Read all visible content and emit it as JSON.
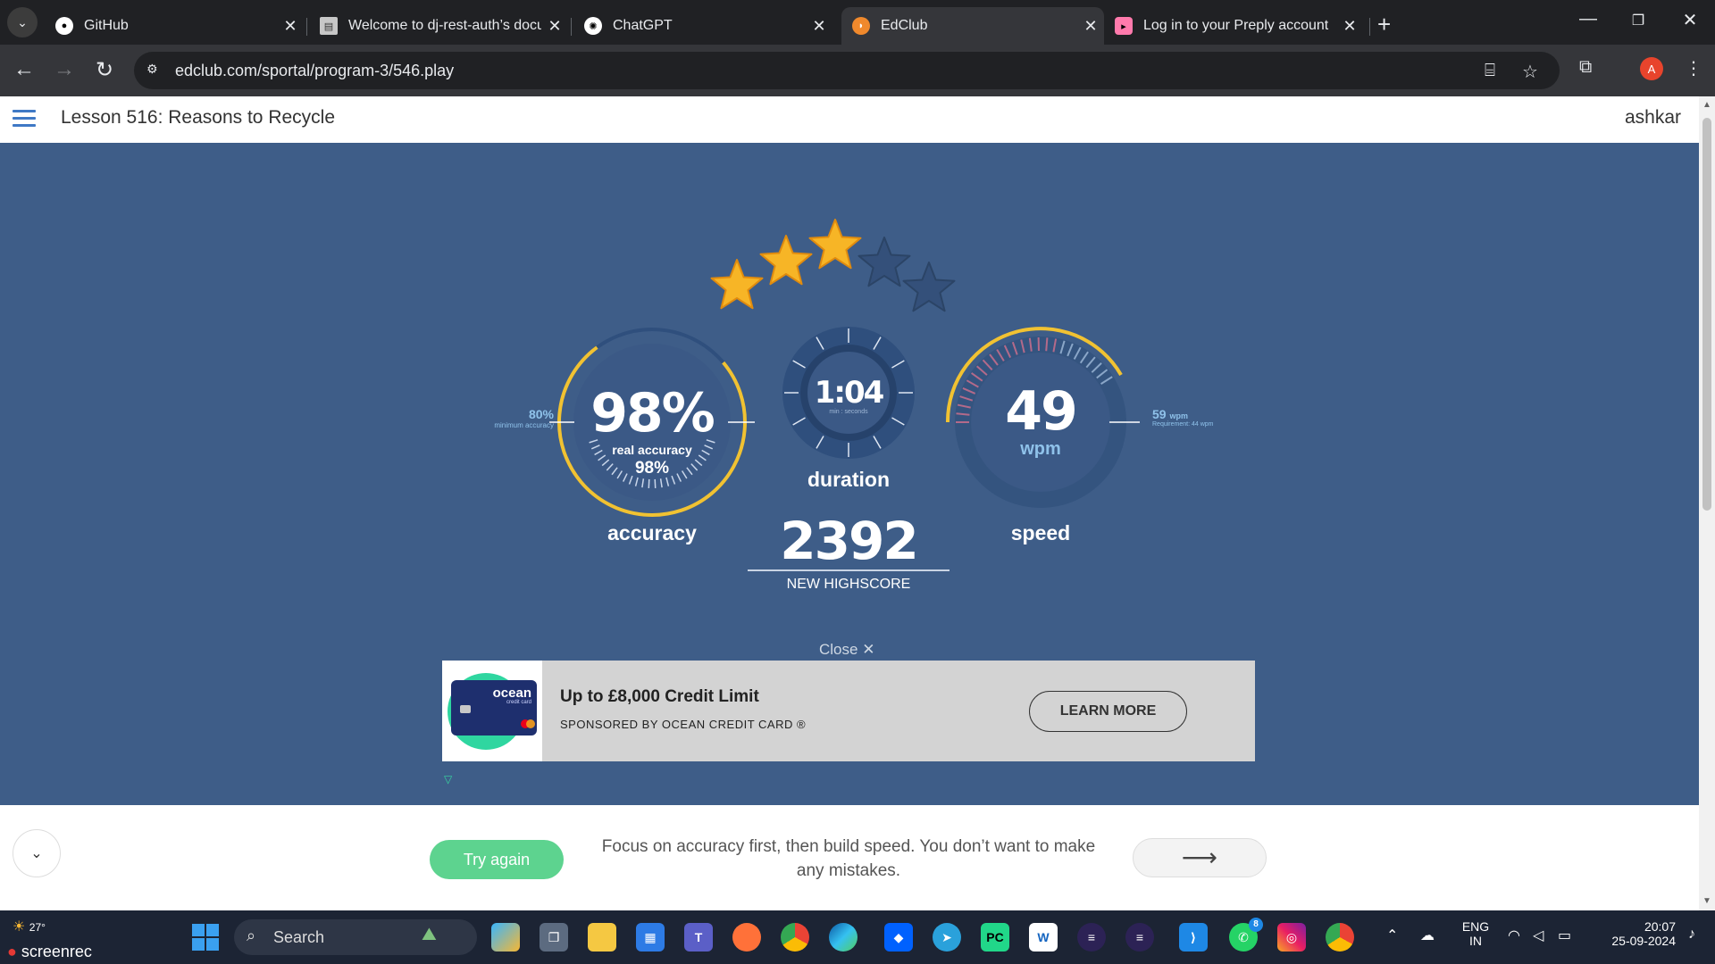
{
  "browser": {
    "tabs": [
      {
        "title": "GitHub",
        "icon": "github-icon"
      },
      {
        "title": "Welcome to dj-rest-auth’s docu",
        "icon": "doc-icon"
      },
      {
        "title": "ChatGPT",
        "icon": "chatgpt-icon"
      },
      {
        "title": "EdClub",
        "icon": "edclub-icon",
        "active": true
      },
      {
        "title": "Log in to your Preply account",
        "icon": "preply-icon"
      }
    ],
    "url": "edclub.com/sportal/program-3/546.play",
    "profile_initial": "A"
  },
  "page": {
    "lesson_title": "Lesson 516: Reasons to Recycle",
    "username": "ashkar",
    "stars_earned": 3,
    "stars_total": 5,
    "accuracy": {
      "value": "98%",
      "sub_label": "real accuracy",
      "sub_value": "98%",
      "label": "accuracy",
      "min_value": "80%",
      "min_label": "minimum accuracy",
      "fraction": 0.98
    },
    "duration": {
      "value": "1:04",
      "unit": "min : seconds",
      "label": "duration"
    },
    "speed": {
      "value": "49",
      "unit": "wpm",
      "label": "speed",
      "req_value": "59",
      "req_unit": "wpm",
      "req_label": "Requirement: 44 wpm"
    },
    "score": {
      "value": "2392",
      "label": "NEW HIGHSCORE"
    },
    "ad": {
      "close_label": "Close",
      "card_brand": "ocean",
      "card_sub": "credit card",
      "title": "Up to £8,000 Credit Limit",
      "sponsor": "SPONSORED BY OCEAN CREDIT CARD ®",
      "button": "LEARN MORE"
    },
    "footer": {
      "try_again": "Try again",
      "tip": "Focus on accuracy first, then build speed. You don’t want to make any mistakes."
    }
  },
  "taskbar": {
    "weather_temp": "27°",
    "recorder": "screenrec",
    "search_placeholder": "Search",
    "lang_top": "ENG",
    "lang_bottom": "IN",
    "time": "20:07",
    "date": "25-09-2024",
    "whatsapp_badge": "8"
  }
}
